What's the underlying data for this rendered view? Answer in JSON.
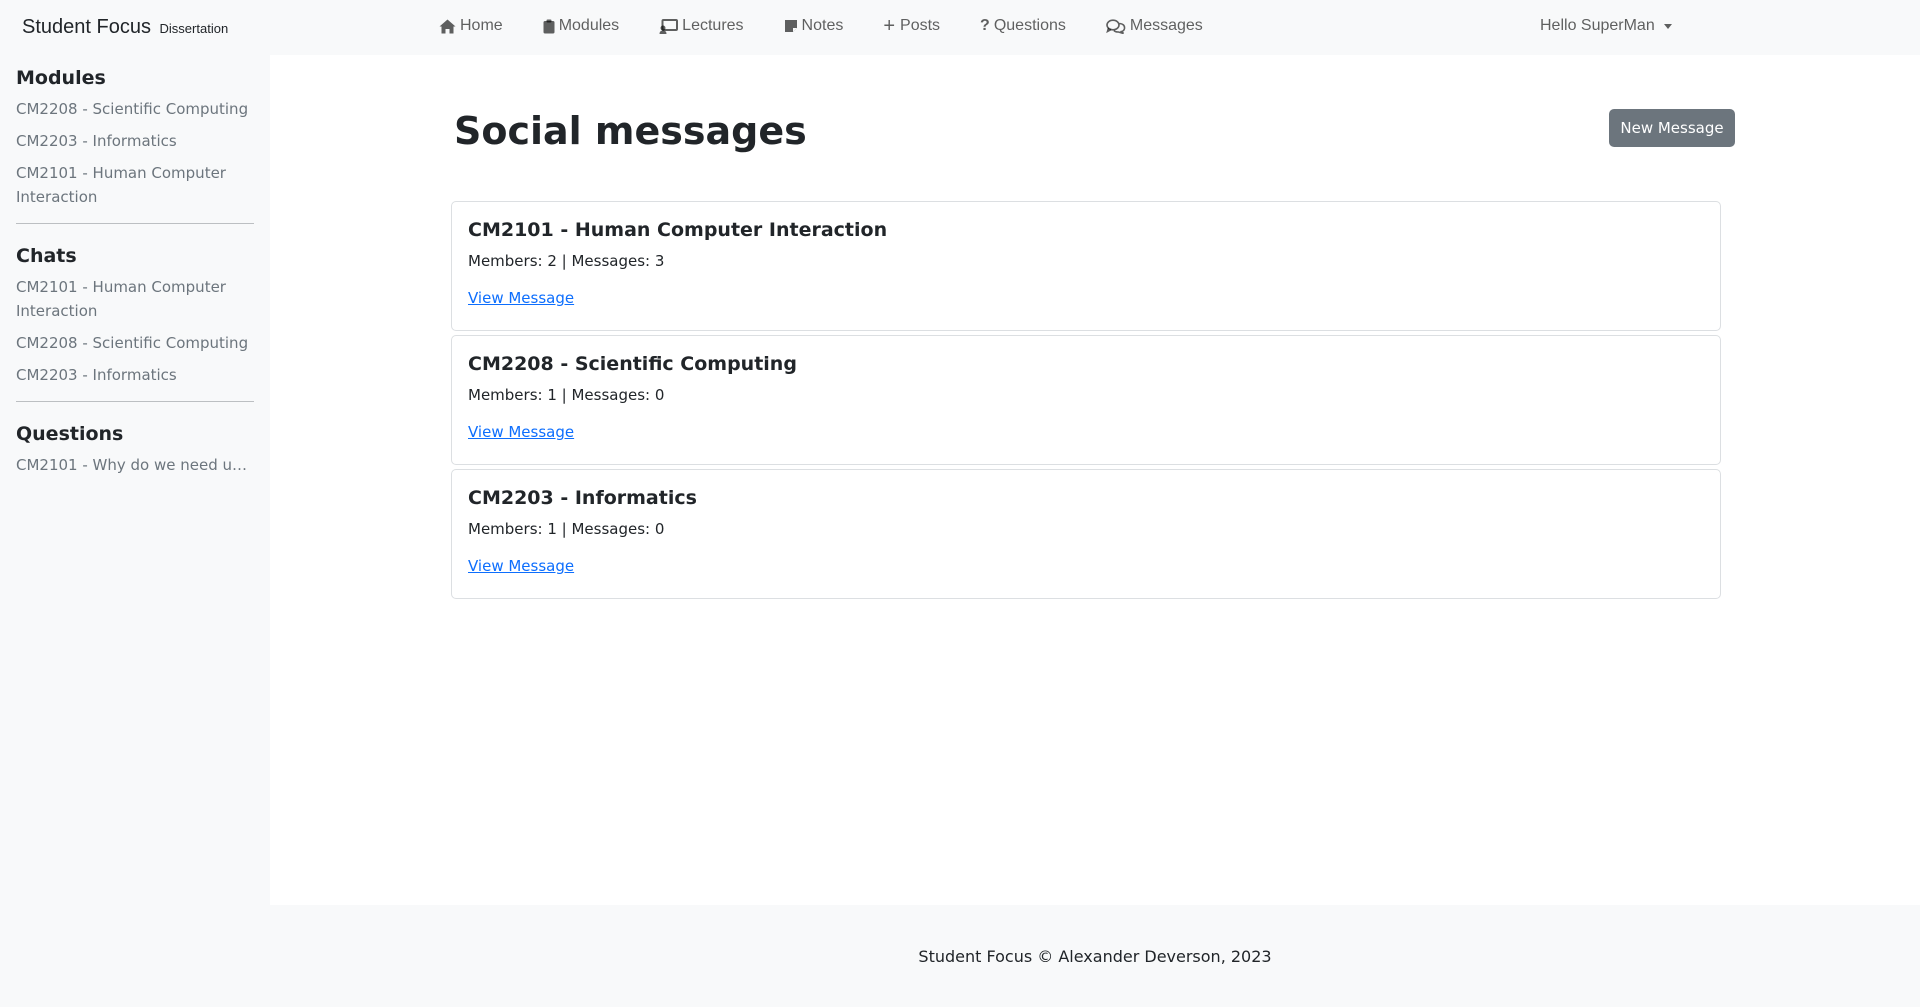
{
  "navbar": {
    "brand": "Student Focus",
    "brand_sub": "Dissertation",
    "links": [
      {
        "label": "Home",
        "icon": "home-icon"
      },
      {
        "label": "Modules",
        "icon": "clipboard-icon"
      },
      {
        "label": "Lectures",
        "icon": "presentation-icon"
      },
      {
        "label": "Notes",
        "icon": "sticky-note-icon"
      },
      {
        "label": "Posts",
        "icon": "plus-icon"
      },
      {
        "label": "Questions",
        "icon": "question-icon"
      },
      {
        "label": "Messages",
        "icon": "chat-bubbles-icon"
      }
    ],
    "user_greeting": "Hello SuperMan"
  },
  "sidebar": {
    "modules_heading": "Modules",
    "modules": [
      "CM2208 - Scientific Computing",
      "CM2203 - Informatics",
      "CM2101 - Human Computer Interaction"
    ],
    "chats_heading": "Chats",
    "chats": [
      "CM2101 - Human Computer Interaction",
      "CM2208 - Scientific Computing",
      "CM2203 - Informatics"
    ],
    "questions_heading": "Questions",
    "questions": [
      "CM2101 - Why do we need use..."
    ]
  },
  "main": {
    "title": "Social messages",
    "new_message_button": "New Message",
    "chats": [
      {
        "title": "CM2101 - Human Computer Interaction",
        "meta": "Members: 2 | Messages: 3",
        "link": "View Message"
      },
      {
        "title": "CM2208 - Scientific Computing",
        "meta": "Members: 1 | Messages: 0",
        "link": "View Message"
      },
      {
        "title": "CM2203 - Informatics",
        "meta": "Members: 1 | Messages: 0",
        "link": "View Message"
      }
    ]
  },
  "footer": {
    "text": "Student Focus © Alexander Deverson, 2023"
  }
}
